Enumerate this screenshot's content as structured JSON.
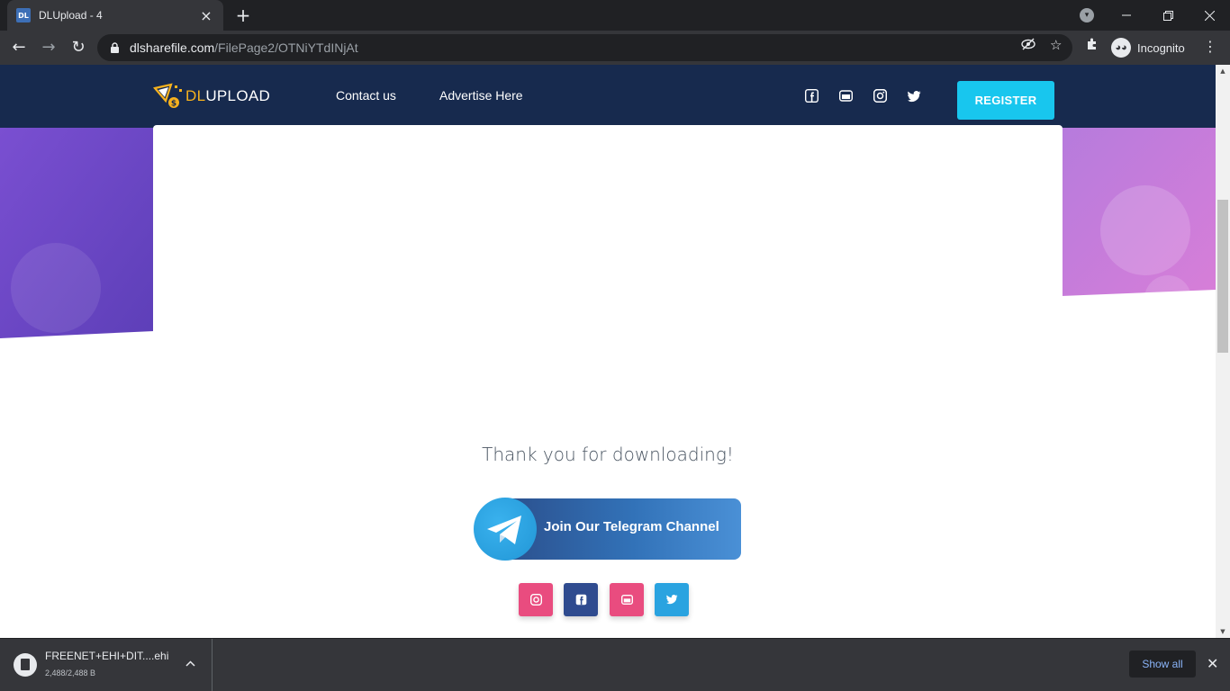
{
  "browser": {
    "tab_title": "DLUpload - 4",
    "favicon_text": "DL",
    "url_host": "dlsharefile.com",
    "url_path": "/FilePage2/OTNiYTdINjAt",
    "profile_label": "Incognito"
  },
  "site": {
    "logo_prefix": "DL",
    "logo_suffix": "UPLOAD",
    "nav": [
      {
        "label": "Contact us"
      },
      {
        "label": "Advertise Here"
      }
    ],
    "register_label": "REGISTER",
    "colors": {
      "header_bg": "#172a4e",
      "accent": "#18c6ee",
      "logo_gold": "#f7b21e",
      "instagram": "#e94c7f",
      "facebook": "#2f4b8f",
      "youtube": "#e94c7f",
      "twitter": "#2aa3e0"
    }
  },
  "main": {
    "thanks_text": "Thank you for downloading!",
    "telegram_label": "Join Our Telegram Channel"
  },
  "download": {
    "file_name": "FREENET+EHI+DIT....ehi",
    "progress": "2,488/2,488 B",
    "show_all": "Show all"
  }
}
